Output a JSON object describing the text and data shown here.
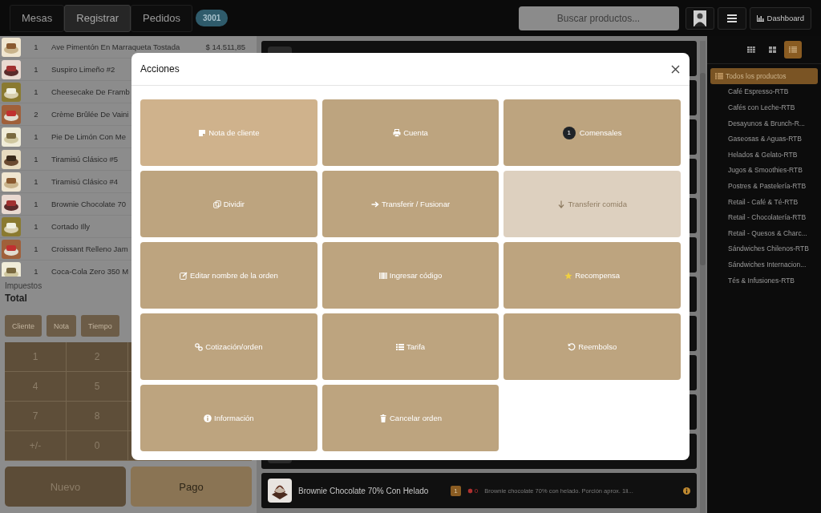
{
  "top_bar": {
    "tabs": [
      {
        "label": "Mesas",
        "selected": false
      },
      {
        "label": "Registrar",
        "selected": true
      },
      {
        "label": "Pedidos",
        "selected": false
      }
    ],
    "order_badge": "3001",
    "search": {
      "placeholder": "Buscar productos..."
    },
    "dashboard_button": "Dashboard"
  },
  "order": {
    "lines": [
      {
        "qty": "1",
        "name": "Ave Pimentón En Marraqueta Tostada",
        "price": "$ 14.511,85"
      },
      {
        "qty": "1",
        "name": "Suspiro Limeño #2"
      },
      {
        "qty": "1",
        "name": "Cheesecake De Framb"
      },
      {
        "qty": "2",
        "name": "Crème Brûlée De Vaini"
      },
      {
        "qty": "1",
        "name": "Pie De Limón Con Me"
      },
      {
        "qty": "1",
        "name": "Tiramisú Clásico #5"
      },
      {
        "qty": "1",
        "name": "Tiramisú Clásico #4"
      },
      {
        "qty": "1",
        "name": "Brownie Chocolate 70"
      },
      {
        "qty": "1",
        "name": "Cortado Illy"
      },
      {
        "qty": "1",
        "name": "Croissant Relleno Jam"
      },
      {
        "qty": "1",
        "name": "Coca-Cola Zero 350 M"
      }
    ],
    "taxes_label": "Impuestos",
    "total_label": "Total",
    "actions": [
      "Cliente",
      "Nota",
      "Tiempo"
    ],
    "keypad": [
      [
        "1",
        "2"
      ],
      [
        "4",
        "5"
      ],
      [
        "7",
        "8"
      ],
      [
        "+/-",
        "0"
      ]
    ],
    "new_button": "Nuevo",
    "pay_button": "Pago"
  },
  "products": {
    "visible_card": {
      "name": "Brownie Chocolate 70% Con Helado",
      "quantity": "1",
      "stock": "0",
      "description": "Brownie chocolate 70% con helado. Porción aprox. 1li..."
    }
  },
  "sidebar": {
    "view_modes": [
      {
        "kind": "grid-small",
        "selected": false
      },
      {
        "kind": "grid-large",
        "selected": false
      },
      {
        "kind": "list",
        "selected": true
      }
    ],
    "categories": [
      {
        "label": "Todos los productos",
        "kind": "all",
        "selected": true
      },
      {
        "label": "Café Espresso-RTB",
        "selected": false
      },
      {
        "label": "Cafés con Leche-RTB",
        "selected": false
      },
      {
        "label": "Desayunos & Brunch-R...",
        "selected": false
      },
      {
        "label": "Gaseosas & Aguas-RTB",
        "selected": false
      },
      {
        "label": "Helados & Gelato-RTB",
        "selected": false
      },
      {
        "label": "Jugos & Smoothies-RTB",
        "selected": false
      },
      {
        "label": "Postres & Pastelería-RTB",
        "selected": false
      },
      {
        "label": "Retail - Café & Té-RTB",
        "selected": false
      },
      {
        "label": "Retail - Chocolatería-RTB",
        "selected": false
      },
      {
        "label": "Retail - Quesos & Charc...",
        "selected": false
      },
      {
        "label": "Sándwiches Chilenos-RTB",
        "selected": false
      },
      {
        "label": "Sándwiches Internacion...",
        "selected": false
      },
      {
        "label": "Tés & Infusiones-RTB",
        "selected": false
      }
    ]
  },
  "modal": {
    "title": "Acciones",
    "actions": [
      {
        "label": "Nota de cliente",
        "selected": true,
        "disabled": false
      },
      {
        "label": "Cuenta",
        "selected": false,
        "disabled": false
      },
      {
        "label": "Comensales",
        "count": "1",
        "selected": false,
        "disabled": false
      },
      {
        "label": "Dividir",
        "selected": false,
        "disabled": false
      },
      {
        "label": "Transferir / Fusionar",
        "selected": false,
        "disabled": false
      },
      {
        "label": "Transferir comida",
        "selected": false,
        "disabled": true
      },
      {
        "label": "Editar nombre de la orden",
        "selected": false,
        "disabled": false
      },
      {
        "label": "Ingresar código",
        "selected": false,
        "disabled": false
      },
      {
        "label": "Recompensa",
        "selected": false,
        "disabled": false
      },
      {
        "label": "Cotización/orden",
        "selected": false,
        "disabled": false
      },
      {
        "label": "Tarifa",
        "selected": false,
        "disabled": false
      },
      {
        "label": "Reembolso",
        "selected": false,
        "disabled": false
      },
      {
        "label": "Información",
        "selected": false,
        "disabled": false
      },
      {
        "label": "Cancelar orden",
        "selected": false,
        "disabled": false
      }
    ]
  }
}
